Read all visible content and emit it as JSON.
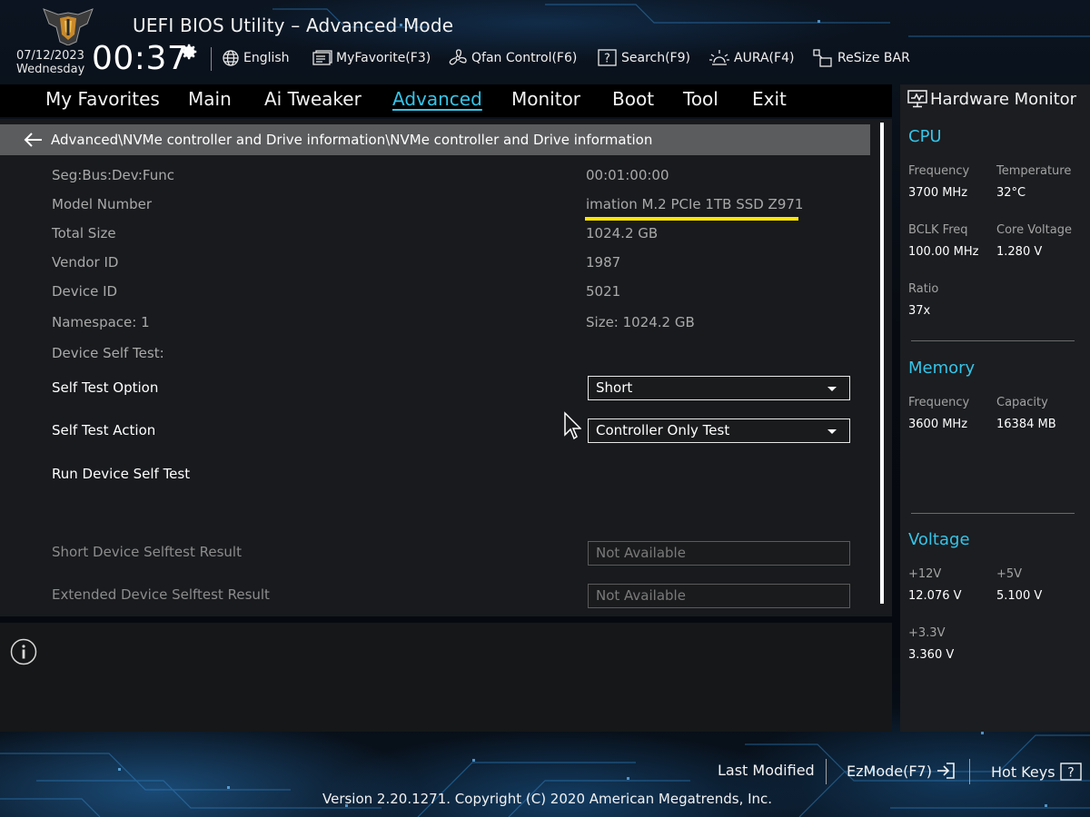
{
  "header": {
    "title": "UEFI BIOS Utility – Advanced Mode",
    "date": "07/12/2023",
    "day": "Wednesday",
    "time": "00:37",
    "toolbar": [
      {
        "label": "English",
        "icon": "globe-icon"
      },
      {
        "label": "MyFavorite(F3)",
        "icon": "favorite-icon"
      },
      {
        "label": "Qfan Control(F6)",
        "icon": "fan-icon"
      },
      {
        "label": "Search(F9)",
        "icon": "search-help-icon"
      },
      {
        "label": "AURA(F4)",
        "icon": "aura-light-icon"
      },
      {
        "label": "ReSize BAR",
        "icon": "resize-bar-icon"
      }
    ]
  },
  "nav": {
    "tabs": [
      {
        "label": "My Favorites"
      },
      {
        "label": "Main"
      },
      {
        "label": "Ai Tweaker"
      },
      {
        "label": "Advanced",
        "active": true
      },
      {
        "label": "Monitor"
      },
      {
        "label": "Boot"
      },
      {
        "label": "Tool"
      },
      {
        "label": "Exit"
      }
    ]
  },
  "breadcrumb": "Advanced\\NVMe controller and Drive information\\NVMe controller and Drive information",
  "info_rows": [
    {
      "label": "Seg:Bus:Dev:Func",
      "value": "00:01:00:00"
    },
    {
      "label": "Model Number",
      "value": "imation M.2 PCIe 1TB SSD Z971"
    },
    {
      "label": "Total Size",
      "value": "1024.2 GB"
    },
    {
      "label": "Vendor ID",
      "value": "1987"
    },
    {
      "label": "Device ID",
      "value": "5021"
    },
    {
      "label": "Namespace: 1",
      "value": "Size: 1024.2 GB"
    }
  ],
  "self_test": {
    "section_label": "Device Self Test:",
    "option_label": "Self Test Option",
    "option_value": "Short",
    "action_label": "Self Test Action",
    "action_value": "Controller Only Test",
    "run_label": "Run Device Self Test",
    "short_result_label": "Short Device Selftest Result",
    "short_result_value": "Not Available",
    "extended_result_label": "Extended Device Selftest Result",
    "extended_result_value": "Not Available"
  },
  "hardware_monitor": {
    "title": "Hardware Monitor",
    "cpu": {
      "heading": "CPU",
      "frequency_label": "Frequency",
      "frequency": "3700 MHz",
      "temperature_label": "Temperature",
      "temperature": "32°C",
      "bclk_label": "BCLK Freq",
      "bclk": "100.00 MHz",
      "core_voltage_label": "Core Voltage",
      "core_voltage": "1.280 V",
      "ratio_label": "Ratio",
      "ratio": "37x"
    },
    "memory": {
      "heading": "Memory",
      "frequency_label": "Frequency",
      "frequency": "3600 MHz",
      "capacity_label": "Capacity",
      "capacity": "16384 MB"
    },
    "voltage": {
      "heading": "Voltage",
      "v12_label": "+12V",
      "v12": "12.076 V",
      "v5_label": "+5V",
      "v5": "5.100 V",
      "v33_label": "+3.3V",
      "v33": "3.360 V"
    }
  },
  "footer": {
    "last_modified": "Last Modified",
    "ezmode": "EzMode(F7)",
    "hotkeys": "Hot Keys",
    "version": "Version 2.20.1271. Copyright (C) 2020 American Megatrends, Inc."
  },
  "colors": {
    "accent": "#36c4e8",
    "highlight_underline": "#ffe600",
    "breadcrumb_bg": "#5b5c5e",
    "panel_bg": "#181a1d"
  }
}
